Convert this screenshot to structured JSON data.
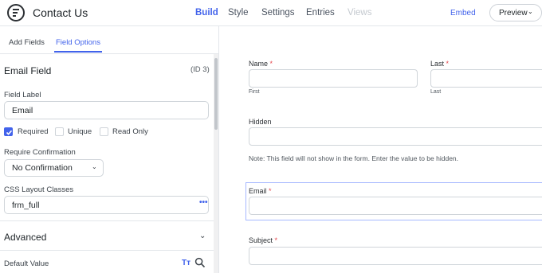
{
  "header": {
    "title": "Contact Us",
    "nav": [
      "Build",
      "Style",
      "Settings",
      "Entries",
      "Views"
    ],
    "embed": "Embed",
    "preview": "Preview"
  },
  "sidebar": {
    "tabs": [
      "Add Fields",
      "Field Options"
    ],
    "field_title": "Email Field",
    "field_id": "(ID 3)",
    "field_label_caption": "Field Label",
    "field_label_value": "Email",
    "checkboxes": [
      {
        "label": "Required",
        "checked": true
      },
      {
        "label": "Unique",
        "checked": false
      },
      {
        "label": "Read Only",
        "checked": false
      }
    ],
    "confirmation_caption": "Require Confirmation",
    "confirmation_value": "No Confirmation",
    "css_caption": "CSS Layout Classes",
    "css_value": "frm_full",
    "css_more": "•••",
    "advanced": "Advanced",
    "default_value_caption": "Default Value",
    "default_value_icon_text": "Tт"
  },
  "form": {
    "name_label": "Name",
    "first_sub": "First",
    "last_label": "Last",
    "last_sub": "Last",
    "hidden_label": "Hidden",
    "hidden_note": "Note: This field will not show in the form. Enter the value to be hidden.",
    "email_label": "Email",
    "subject_label": "Subject",
    "required_marker": "*"
  },
  "colors": {
    "accent": "#4263eb",
    "required": "#e5484d",
    "selected_border": "#a7b9ff"
  }
}
